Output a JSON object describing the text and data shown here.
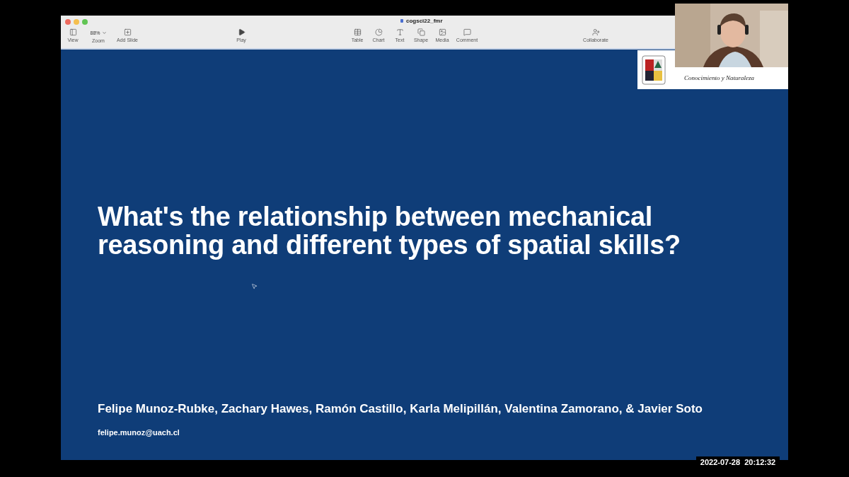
{
  "window": {
    "title": "cogsci22_fmr"
  },
  "toolbar_groups": [
    [
      {
        "label": "View"
      },
      {
        "label": "Zoom",
        "value": "88%"
      },
      {
        "label": "Add Slide"
      }
    ],
    [
      {
        "label": "Play"
      }
    ],
    [
      {
        "label": "Table"
      },
      {
        "label": "Chart"
      },
      {
        "label": "Text"
      },
      {
        "label": "Shape"
      },
      {
        "label": "Media"
      },
      {
        "label": "Comment"
      }
    ],
    [
      {
        "label": "Collaborate"
      }
    ]
  ],
  "slide": {
    "logo": {
      "motto": "Conocimiento y Naturaleza"
    },
    "title": "What's the relationship between mechanical reasoning and different types of spatial skills?",
    "authors": "Felipe Munoz-Rubke, Zachary Hawes, Ramón Castillo, Karla Melipillán, Valentina Zamorano, & Javier Soto",
    "email": "felipe.munoz@uach.cl"
  },
  "timestamp": "2022-07-28  20:12:32"
}
